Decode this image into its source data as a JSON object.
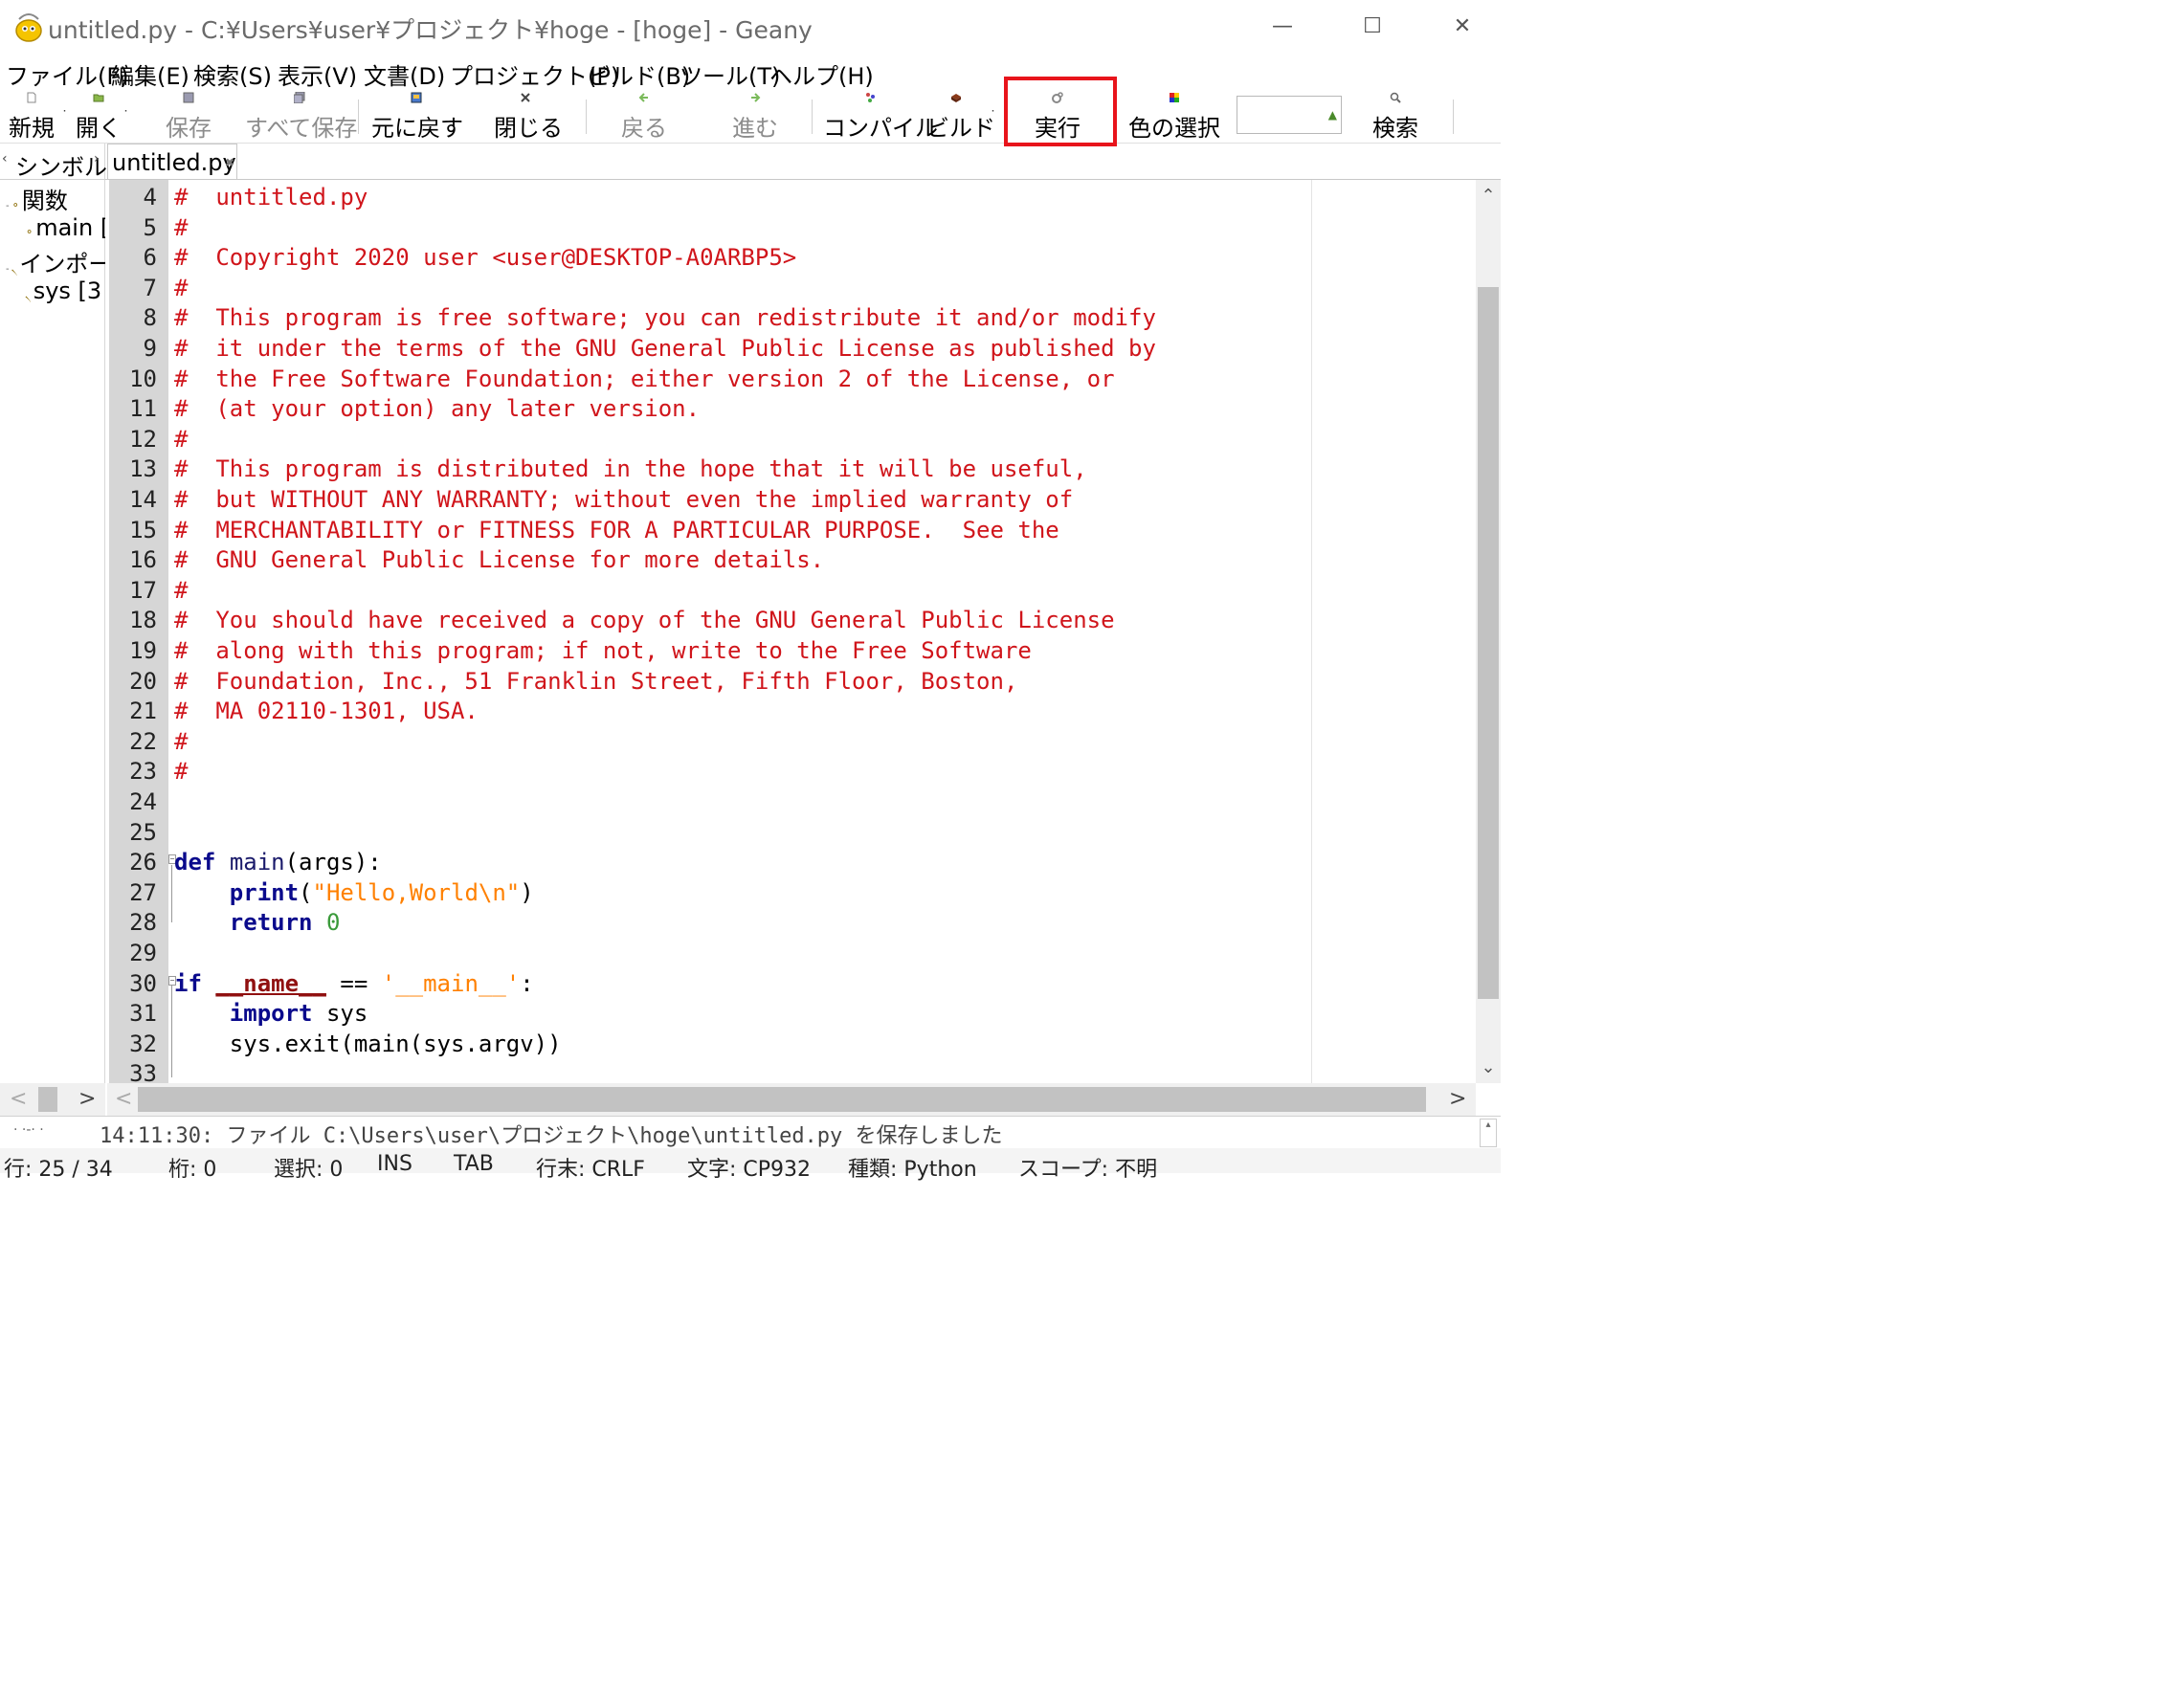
{
  "window": {
    "title": "untitled.py - C:¥Users¥user¥プロジェクト¥hoge - [hoge] - Geany",
    "minimize_glyph": "—",
    "maximize_glyph": "☐",
    "close_glyph": "✕"
  },
  "menu": [
    "ファイル(F)",
    "編集(E)",
    "検索(S)",
    "表示(V)",
    "文書(D)",
    "プロジェクト(P)",
    "ビルド(B)",
    "ツール(T)",
    "ヘルプ(H)"
  ],
  "toolbar": {
    "new": "新規",
    "open": "開く",
    "save": "保存",
    "save_all": "すべて保存",
    "revert": "元に戻す",
    "close": "閉じる",
    "back": "戻る",
    "forward": "進む",
    "compile": "コンパイル",
    "build": "ビルド",
    "run": "実行",
    "color": "色の選択",
    "search": "検索",
    "dropdown_glyph": "˙"
  },
  "sidebar": {
    "tab_label": "シンボル",
    "tree": [
      {
        "label": "関数",
        "level": 0
      },
      {
        "label": "main [",
        "level": 1
      },
      {
        "label": "インポー",
        "level": 0
      },
      {
        "label": "sys [3",
        "level": 1
      }
    ]
  },
  "document_tab": {
    "label": "untitled.py",
    "close_glyph": "✖"
  },
  "editor": {
    "lines": [
      {
        "n": "4",
        "html": "<span class=\"cm\">#  untitled.py</span>"
      },
      {
        "n": "5",
        "html": "<span class=\"cm\">#</span>"
      },
      {
        "n": "6",
        "html": "<span class=\"cm\">#  Copyright 2020 user &lt;user@DESKTOP-A0ARBP5&gt;</span>"
      },
      {
        "n": "7",
        "html": "<span class=\"cm\">#</span>"
      },
      {
        "n": "8",
        "html": "<span class=\"cm\">#  This program is free software; you can redistribute it and/or modify</span>"
      },
      {
        "n": "9",
        "html": "<span class=\"cm\">#  it under the terms of the GNU General Public License as published by</span>"
      },
      {
        "n": "10",
        "html": "<span class=\"cm\">#  the Free Software Foundation; either version 2 of the License, or</span>"
      },
      {
        "n": "11",
        "html": "<span class=\"cm\">#  (at your option) any later version.</span>"
      },
      {
        "n": "12",
        "html": "<span class=\"cm\">#</span>"
      },
      {
        "n": "13",
        "html": "<span class=\"cm\">#  This program is distributed in the hope that it will be useful,</span>"
      },
      {
        "n": "14",
        "html": "<span class=\"cm\">#  but WITHOUT ANY WARRANTY; without even the implied warranty of</span>"
      },
      {
        "n": "15",
        "html": "<span class=\"cm\">#  MERCHANTABILITY or FITNESS FOR A PARTICULAR PURPOSE.  See the</span>"
      },
      {
        "n": "16",
        "html": "<span class=\"cm\">#  GNU General Public License for more details.</span>"
      },
      {
        "n": "17",
        "html": "<span class=\"cm\">#</span>"
      },
      {
        "n": "18",
        "html": "<span class=\"cm\">#  You should have received a copy of the GNU General Public License</span>"
      },
      {
        "n": "19",
        "html": "<span class=\"cm\">#  along with this program; if not, write to the Free Software</span>"
      },
      {
        "n": "20",
        "html": "<span class=\"cm\">#  Foundation, Inc., 51 Franklin Street, Fifth Floor, Boston,</span>"
      },
      {
        "n": "21",
        "html": "<span class=\"cm\">#  MA 02110-1301, USA.</span>"
      },
      {
        "n": "22",
        "html": "<span class=\"cm\">#</span>"
      },
      {
        "n": "23",
        "html": "<span class=\"cm\">#</span>"
      },
      {
        "n": "24",
        "html": ""
      },
      {
        "n": "25",
        "html": ""
      },
      {
        "n": "26",
        "html": "<span class=\"kw\">def</span> <span class=\"fn\">main</span>(args):",
        "fold": true
      },
      {
        "n": "27",
        "html": "    <span class=\"kw\">print</span>(<span class=\"str\">\"Hello,World\\n\"</span>)"
      },
      {
        "n": "28",
        "html": "    <span class=\"kw\">return</span> <span class=\"num\">0</span>"
      },
      {
        "n": "29",
        "html": ""
      },
      {
        "n": "30",
        "html": "<span class=\"kw\">if</span> <span class=\"dunder\">__name__</span> == <span class=\"str\">'__main__'</span>:",
        "fold": true
      },
      {
        "n": "31",
        "html": "    <span class=\"kw\">import</span> sys"
      },
      {
        "n": "32",
        "html": "    sys.exit(main(sys.argv))"
      },
      {
        "n": "33",
        "html": ""
      }
    ]
  },
  "message": "14:11:30: ファイル C:\\Users\\user\\プロジェクト\\hoge\\untitled.py を保存しました",
  "status": {
    "line": "行: 25 / 34",
    "col": "桁: 0",
    "sel": "選択: 0",
    "ins": "INS",
    "tab": "TAB",
    "eol": "行末: CRLF",
    "enc": "文字: CP932",
    "type": "種類: Python",
    "scope": "スコープ: 不明"
  },
  "colors": {
    "comment": "#d0151b",
    "keyword": "#0a0a8c",
    "string": "#ff8000",
    "number": "#3a9a3a",
    "highlight": "#e8141b"
  }
}
